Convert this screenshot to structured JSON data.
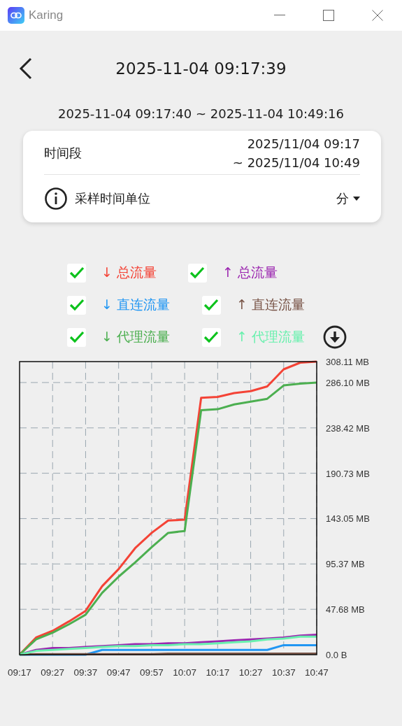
{
  "window": {
    "title": "Karing"
  },
  "header": {
    "title": "2025-11-04 09:17:39"
  },
  "range": "2025-11-04 09:17:40 ~ 2025-11-04 10:49:16",
  "card": {
    "period_label": "时间段",
    "period_start": "2025/11/04 09:17",
    "period_end": "~ 2025/11/04 10:49",
    "unit_label": "采样时间单位",
    "unit_value": "分"
  },
  "legend": [
    {
      "checked": true
    },
    {
      "checked": true
    },
    {
      "checked": true
    },
    {
      "checked": true
    },
    {
      "checked": true
    },
    {
      "checked": true
    }
  ],
  "chart_data": {
    "type": "line",
    "grid": true,
    "categories": [
      "09:17",
      null,
      "09:27",
      null,
      "09:37",
      null,
      "09:47",
      null,
      "09:57",
      null,
      "10:07",
      null,
      "10:17",
      null,
      "10:27",
      null,
      "10:37",
      null,
      "10:47"
    ],
    "ylim": [
      0,
      308.11
    ],
    "yticks": [
      {
        "value": 0,
        "label": "0.0 B"
      },
      {
        "value": 47.68,
        "label": "47.68 MB"
      },
      {
        "value": 95.37,
        "label": "95.37 MB"
      },
      {
        "value": 143.05,
        "label": "143.05 MB"
      },
      {
        "value": 190.73,
        "label": "190.73 MB"
      },
      {
        "value": 238.42,
        "label": "238.42 MB"
      },
      {
        "value": 286.1,
        "label": "286.10 MB"
      },
      {
        "value": 308.11,
        "label": "308.11 MB"
      }
    ],
    "series": [
      {
        "name": "↓ 总流量",
        "color": "#f44336",
        "values": [
          0,
          18,
          25,
          35,
          46,
          72,
          90,
          112,
          128,
          141,
          142,
          270,
          271,
          275,
          277,
          282,
          300,
          307,
          308
        ]
      },
      {
        "name": "↑ 总流量",
        "color": "#9c27b0",
        "values": [
          0,
          5,
          7,
          7,
          8,
          9,
          10,
          11,
          11,
          12,
          12,
          13,
          14,
          15,
          16,
          17,
          18,
          20,
          21
        ]
      },
      {
        "name": "↓ 直连流量",
        "color": "#2196f3",
        "values": [
          0,
          0,
          0,
          0,
          0,
          5,
          5,
          5,
          5,
          5,
          5,
          5,
          5,
          5,
          5,
          5,
          10,
          10,
          10
        ]
      },
      {
        "name": "↑ 直连流量",
        "color": "#795548",
        "values": [
          0,
          0.5,
          0.5,
          0.5,
          0.5,
          0.5,
          0.5,
          0.5,
          0.5,
          1,
          1,
          1,
          1,
          1,
          1,
          1,
          1,
          1,
          1
        ]
      },
      {
        "name": "↓ 代理流量",
        "color": "#4caf50",
        "values": [
          0,
          16,
          23,
          32,
          42,
          65,
          82,
          97,
          113,
          128,
          130,
          257,
          258,
          263,
          266,
          269,
          283,
          285,
          286
        ]
      },
      {
        "name": "↑ 代理流量",
        "color": "#69f0ae",
        "values": [
          0,
          4,
          5,
          6,
          7,
          8,
          9,
          9,
          10,
          10,
          11,
          11,
          12,
          13,
          14,
          16,
          17,
          19,
          19
        ]
      }
    ]
  }
}
